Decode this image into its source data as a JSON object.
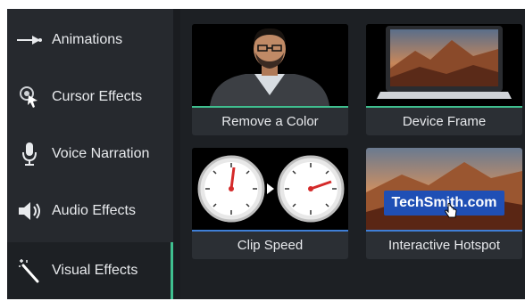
{
  "sidebar": {
    "items": [
      {
        "label": "Animations",
        "icon": "arrow-right-icon"
      },
      {
        "label": "Cursor Effects",
        "icon": "cursor-icon"
      },
      {
        "label": "Voice Narration",
        "icon": "microphone-icon"
      },
      {
        "label": "Audio Effects",
        "icon": "speaker-icon"
      },
      {
        "label": "Visual Effects",
        "icon": "magic-wand-icon",
        "active": true
      }
    ]
  },
  "tiles": [
    {
      "label": "Remove a Color",
      "bar_color": "#3fbf8f"
    },
    {
      "label": "Device Frame",
      "bar_color": "#3fbf8f"
    },
    {
      "label": "Clip Speed",
      "bar_color": "#3f7fd6"
    },
    {
      "label": "Interactive Hotspot",
      "bar_color": "#3f7fd6"
    }
  ],
  "hotspot_text": "TechSmith.com",
  "colors": {
    "accent": "#3fbf8f",
    "panel": "#26292e",
    "background": "#1d2024"
  }
}
